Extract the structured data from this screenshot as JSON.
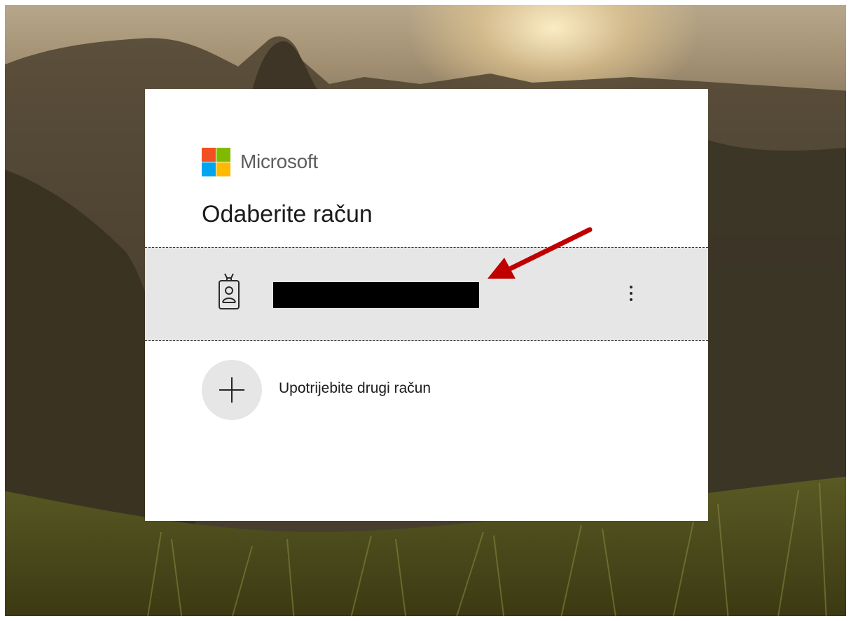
{
  "brand": {
    "name": "Microsoft",
    "logo_colors": [
      "#f25022",
      "#7fba00",
      "#00a4ef",
      "#ffb900"
    ]
  },
  "dialog": {
    "title": "Odaberite račun"
  },
  "account": {
    "icon": "badge-person-icon",
    "more_icon": "more-vertical-icon"
  },
  "other_account": {
    "icon": "plus-icon",
    "label": "Upotrijebite drugi račun"
  },
  "annotation": {
    "arrow_color": "#c00000"
  }
}
